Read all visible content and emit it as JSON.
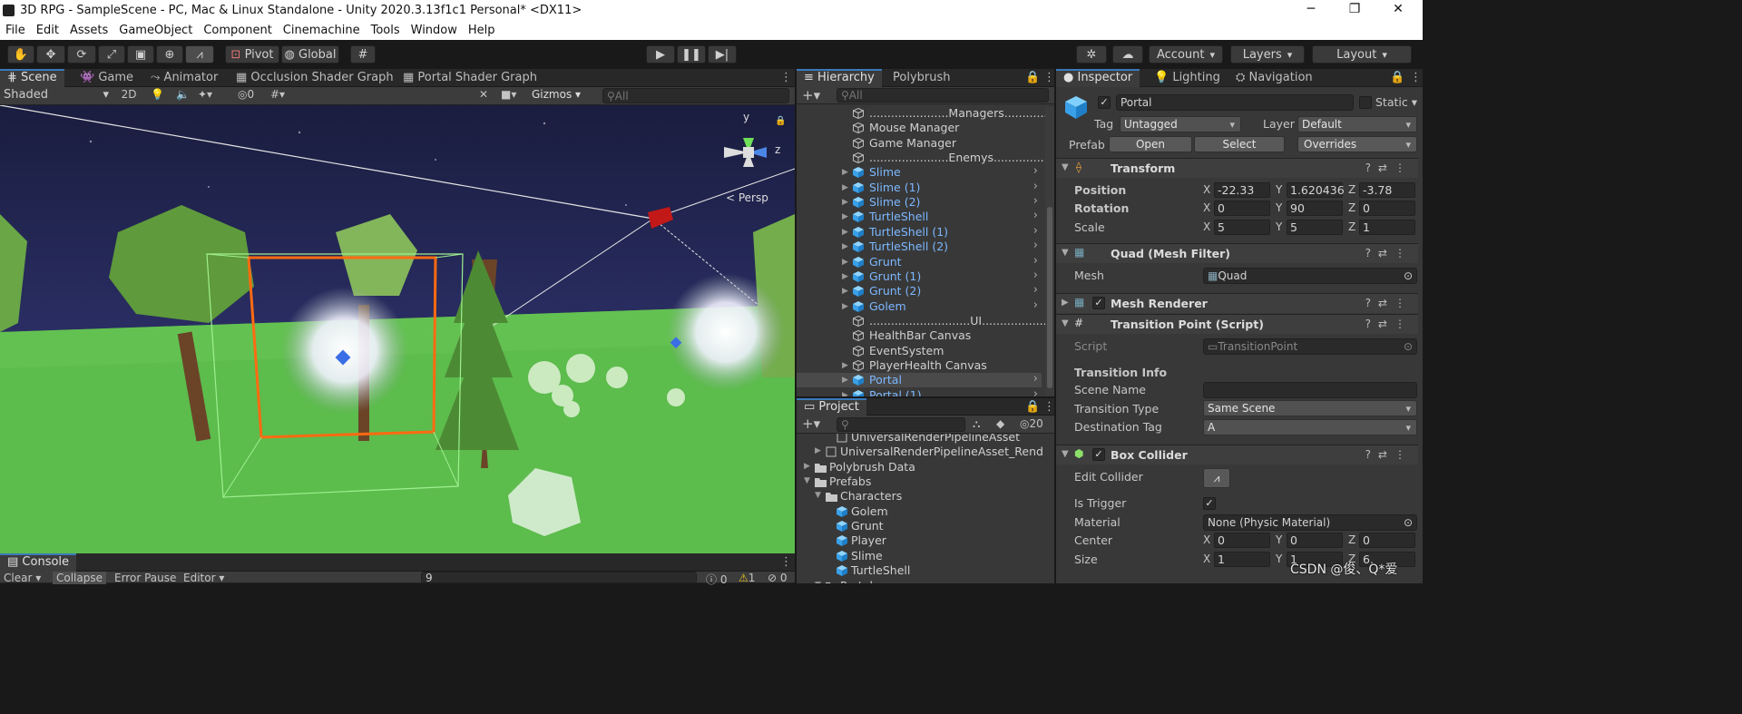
{
  "window": {
    "title": "3D RPG - SampleScene - PC, Mac & Linux Standalone - Unity 2020.3.13f1c1 Personal* <DX11>",
    "minimize": "─",
    "maximize": "❐",
    "close": "✕"
  },
  "menu": [
    "File",
    "Edit",
    "Assets",
    "GameObject",
    "Component",
    "Cinemachine",
    "Tools",
    "Window",
    "Help"
  ],
  "toolbar": {
    "pivot": "Pivot",
    "global": "Global",
    "account": "Account",
    "layers": "Layers",
    "layout": "Layout"
  },
  "scene_tabs": [
    "Scene",
    "Game",
    "Animator",
    "Occlusion Shader Graph",
    "Portal Shader Graph"
  ],
  "scene_bar": {
    "shading": "Shaded",
    "mode_2d": "2D",
    "hidden_count": "0",
    "gizmos": "Gizmos",
    "search_placeholder": "All"
  },
  "gizmo": {
    "y": "y",
    "z": "z",
    "persp": "< Persp"
  },
  "hierarchy": {
    "tabs": [
      "Hierarchy",
      "Polybrush"
    ],
    "search_placeholder": "All",
    "items": [
      {
        "label": "......................Managers...................",
        "prefab": false,
        "arrow": false,
        "chev": false
      },
      {
        "label": "Mouse Manager",
        "prefab": false,
        "arrow": false,
        "chev": false
      },
      {
        "label": "Game Manager",
        "prefab": false,
        "arrow": false,
        "chev": false
      },
      {
        "label": "......................Enemys......................",
        "prefab": false,
        "arrow": false,
        "chev": false
      },
      {
        "label": "Slime",
        "prefab": true,
        "arrow": true,
        "chev": true
      },
      {
        "label": "Slime (1)",
        "prefab": true,
        "arrow": true,
        "chev": true
      },
      {
        "label": "Slime (2)",
        "prefab": true,
        "arrow": true,
        "chev": true
      },
      {
        "label": "TurtleShell",
        "prefab": true,
        "arrow": true,
        "chev": true
      },
      {
        "label": "TurtleShell (1)",
        "prefab": true,
        "arrow": true,
        "chev": true
      },
      {
        "label": "TurtleShell (2)",
        "prefab": true,
        "arrow": true,
        "chev": true
      },
      {
        "label": "Grunt",
        "prefab": true,
        "arrow": true,
        "chev": true
      },
      {
        "label": "Grunt (1)",
        "prefab": true,
        "arrow": true,
        "chev": true
      },
      {
        "label": "Grunt (2)",
        "prefab": true,
        "arrow": true,
        "chev": true
      },
      {
        "label": "Golem",
        "prefab": true,
        "arrow": true,
        "chev": true
      },
      {
        "label": "............................UI.............................",
        "prefab": false,
        "arrow": false,
        "chev": false
      },
      {
        "label": "HealthBar Canvas",
        "prefab": false,
        "arrow": false,
        "chev": false
      },
      {
        "label": "EventSystem",
        "prefab": false,
        "arrow": false,
        "chev": false
      },
      {
        "label": "PlayerHealth Canvas",
        "prefab": false,
        "arrow": true,
        "chev": false
      },
      {
        "label": "Portal",
        "prefab": true,
        "arrow": true,
        "chev": true,
        "selected": true
      },
      {
        "label": "Portal  (1)",
        "prefab": true,
        "arrow": true,
        "chev": true
      }
    ]
  },
  "project": {
    "tab": "Project",
    "count": "20",
    "items": [
      {
        "label": "UniversalRenderPipelineAsset",
        "indent": 3,
        "type": "asset"
      },
      {
        "label": "UniversalRenderPipelineAsset_Rend",
        "indent": 2,
        "type": "asset",
        "arrow": "▶"
      },
      {
        "label": "Polybrush Data",
        "indent": 1,
        "type": "folder",
        "arrow": "▶"
      },
      {
        "label": "Prefabs",
        "indent": 1,
        "type": "folder",
        "arrow": "▼"
      },
      {
        "label": "Characters",
        "indent": 2,
        "type": "folder",
        "arrow": "▼"
      },
      {
        "label": "Golem",
        "indent": 3,
        "type": "prefab"
      },
      {
        "label": "Grunt",
        "indent": 3,
        "type": "prefab"
      },
      {
        "label": "Player",
        "indent": 3,
        "type": "prefab"
      },
      {
        "label": "Slime",
        "indent": 3,
        "type": "prefab"
      },
      {
        "label": "TurtleShell",
        "indent": 3,
        "type": "prefab"
      },
      {
        "label": "Portal",
        "indent": 2,
        "type": "folder",
        "arrow": "▼"
      }
    ]
  },
  "console": {
    "tab": "Console",
    "clear": "Clear",
    "collapse": "Collapse",
    "error_pause": "Error Pause",
    "editor": "Editor",
    "log": "0",
    "warn": "1",
    "err": "0",
    "search": "9"
  },
  "inspector": {
    "tabs": [
      "Inspector",
      "Lighting",
      "Navigation"
    ],
    "name": "Portal",
    "static": "Static",
    "tag_label": "Tag",
    "tag": "Untagged",
    "layer_label": "Layer",
    "layer": "Default",
    "prefab_label": "Prefab",
    "open": "Open",
    "select": "Select",
    "overrides": "Overrides",
    "transform": {
      "title": "Transform",
      "position_label": "Position",
      "rotation_label": "Rotation",
      "scale_label": "Scale",
      "position": [
        "-22.33",
        "1.620436",
        "-3.78"
      ],
      "rotation": [
        "0",
        "90",
        "0"
      ],
      "scale": [
        "5",
        "5",
        "1"
      ]
    },
    "mesh_filter": {
      "title": "Quad (Mesh Filter)",
      "mesh_label": "Mesh",
      "mesh": "Quad"
    },
    "mesh_renderer": {
      "title": "Mesh Renderer"
    },
    "transition": {
      "title": "Transition Point (Script)",
      "script_label": "Script",
      "script": "TransitionPoint",
      "header": "Transition Info",
      "scene_name_label": "Scene Name",
      "scene_name": "",
      "type_label": "Transition Type",
      "type": "Same Scene",
      "dest_label": "Destination Tag",
      "dest": "A"
    },
    "box_collider": {
      "title": "Box Collider",
      "edit_label": "Edit Collider",
      "trigger_label": "Is Trigger",
      "material_label": "Material",
      "material": "None (Physic Material)",
      "center_label": "Center",
      "center": [
        "0",
        "0",
        "0"
      ],
      "size_label": "Size",
      "size": [
        "1",
        "1",
        "6."
      ]
    }
  },
  "watermark": "CSDN @俊、Q*爱",
  "axis": {
    "x": "X",
    "y": "Y",
    "z": "Z"
  }
}
